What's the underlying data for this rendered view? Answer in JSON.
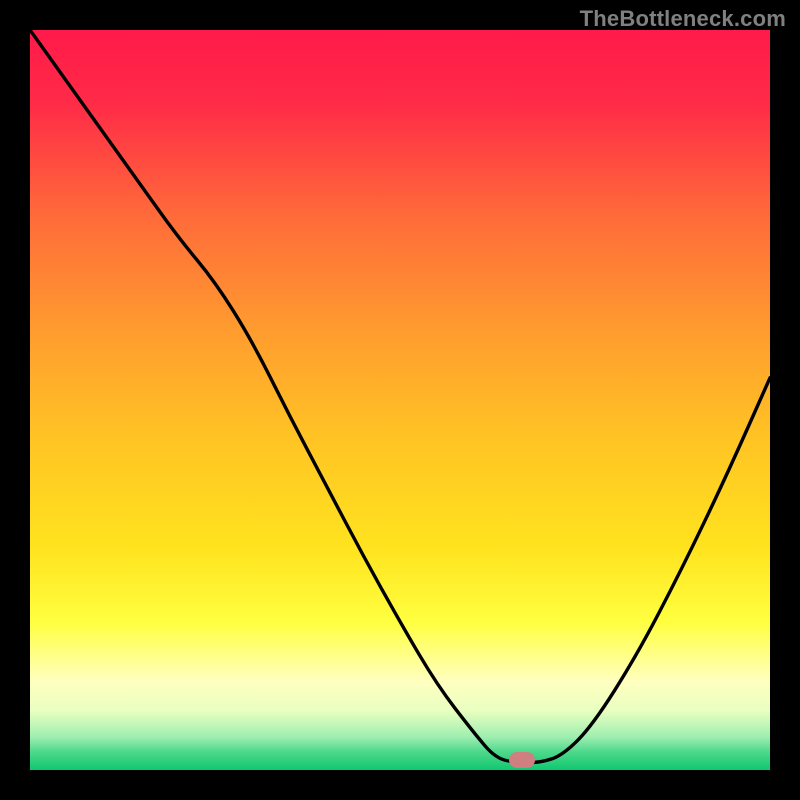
{
  "watermark": {
    "text": "TheBottleneck.com"
  },
  "gradient": {
    "stops": [
      {
        "offset": 0.0,
        "color": "#ff1a4a"
      },
      {
        "offset": 0.1,
        "color": "#ff2b47"
      },
      {
        "offset": 0.25,
        "color": "#ff6a3a"
      },
      {
        "offset": 0.4,
        "color": "#ff9a2f"
      },
      {
        "offset": 0.55,
        "color": "#ffc324"
      },
      {
        "offset": 0.7,
        "color": "#ffe31e"
      },
      {
        "offset": 0.8,
        "color": "#ffff40"
      },
      {
        "offset": 0.88,
        "color": "#ffffbf"
      },
      {
        "offset": 0.92,
        "color": "#e8ffc0"
      },
      {
        "offset": 0.955,
        "color": "#9fefb0"
      },
      {
        "offset": 0.975,
        "color": "#4fd98c"
      },
      {
        "offset": 1.0,
        "color": "#10c770"
      }
    ]
  },
  "marker": {
    "x_frac": 0.665,
    "y_frac": 0.987,
    "color": "#cf7f7f"
  },
  "chart_data": {
    "type": "line",
    "title": "",
    "xlabel": "",
    "ylabel": "",
    "xlim": [
      0,
      1
    ],
    "ylim": [
      0,
      1
    ],
    "series": [
      {
        "name": "bottleneck-curve",
        "x": [
          0.0,
          0.05,
          0.1,
          0.15,
          0.2,
          0.25,
          0.3,
          0.35,
          0.4,
          0.45,
          0.5,
          0.55,
          0.6,
          0.63,
          0.66,
          0.69,
          0.72,
          0.76,
          0.82,
          0.88,
          0.94,
          1.0
        ],
        "y": [
          1.0,
          0.93,
          0.86,
          0.79,
          0.72,
          0.66,
          0.58,
          0.48,
          0.385,
          0.29,
          0.2,
          0.115,
          0.05,
          0.015,
          0.01,
          0.01,
          0.02,
          0.06,
          0.155,
          0.27,
          0.395,
          0.53
        ]
      }
    ],
    "optimal_point": {
      "x": 0.665,
      "y": 0.013
    }
  }
}
